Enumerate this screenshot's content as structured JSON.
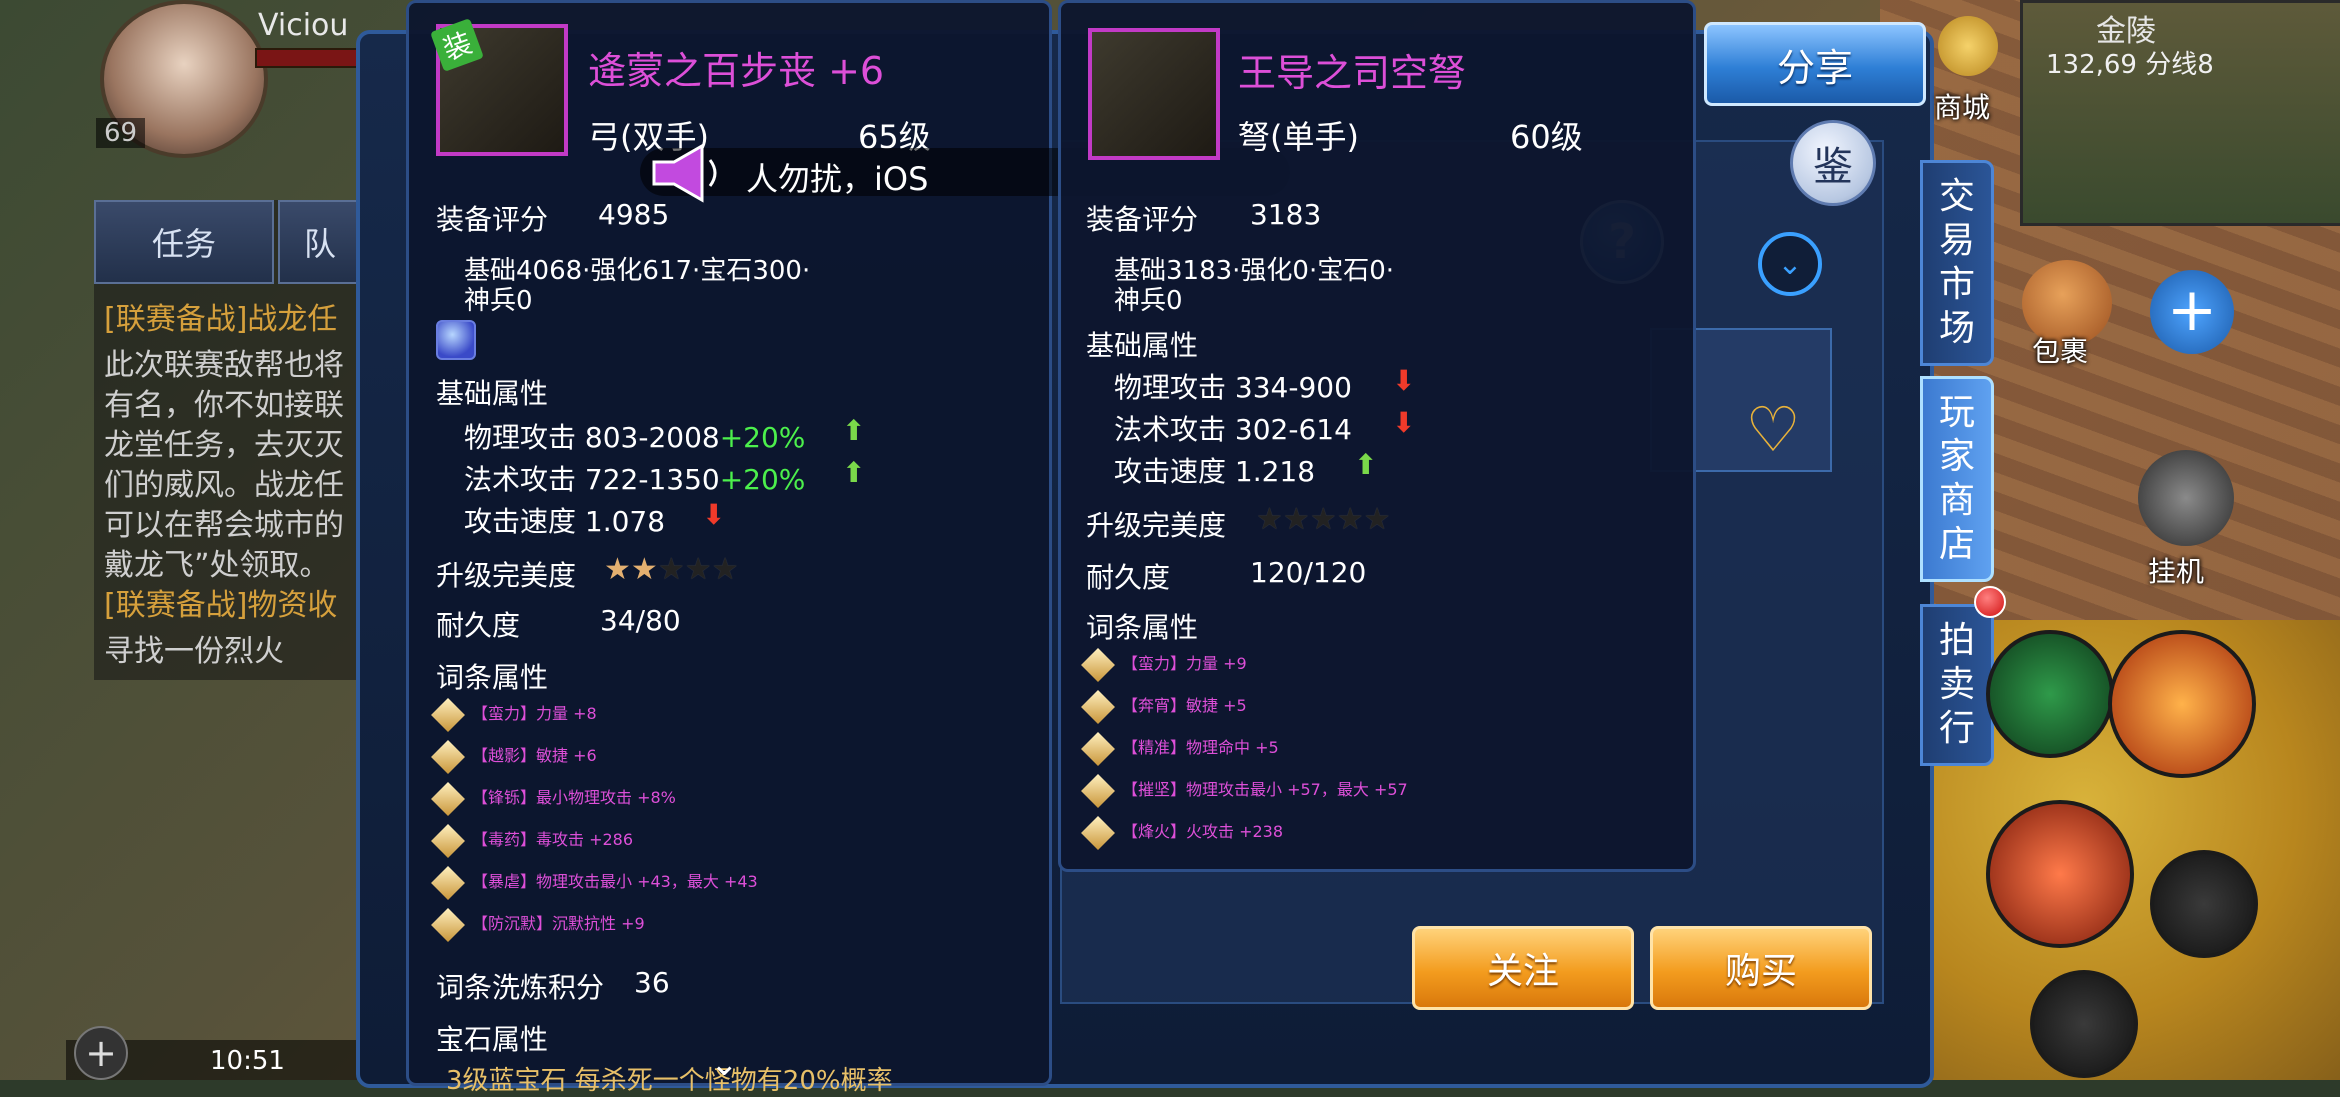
{
  "player": {
    "name": "Viciou",
    "level": "69"
  },
  "quest": {
    "tab_task": "任务",
    "tab_team": "队",
    "lines": [
      "[联赛备战]战龙任",
      "此次联赛敌帮也将",
      "有名，你不如接联",
      "龙堂任务，去灭灭",
      "们的威风。战龙任",
      "可以在帮会城市的",
      "戴龙飞”处领取。",
      "[联赛备战]物资收",
      "寻找一份烈火"
    ]
  },
  "status": {
    "time": "10:51"
  },
  "broadcast": {
    "text": "人勿扰，iOS"
  },
  "left_item": {
    "badge": "装",
    "name": "逄蒙之百步丧 +6",
    "type": "弓(双手)",
    "level": "65级",
    "score_label": "装备评分",
    "score": "4985",
    "score_breakdown_1": "基础4068·强化617·宝石300·",
    "score_breakdown_2": "神兵0",
    "base_header": "基础属性",
    "base_attrs": [
      {
        "name": "物理攻击 803-2008",
        "bonus": "+20%",
        "trend": "up"
      },
      {
        "name": "法术攻击 722-1350",
        "bonus": "+20%",
        "trend": "up"
      },
      {
        "name": "攻击速度 1.078",
        "bonus": "",
        "trend": "down"
      }
    ],
    "upgrade_label": "升级完美度",
    "upgrade_stars": 2,
    "upgrade_stars_max": 5,
    "durability_label": "耐久度",
    "durability": "34/80",
    "affix_header": "词条属性",
    "affixes": [
      "【蛮力】力量 +8",
      "【越影】敏捷 +6",
      "【锋铄】最小物理攻击 +8%",
      "【毒药】毒攻击 +286",
      "【暴虐】物理攻击最小 +43，最大 +43",
      "【防沉默】沉默抗性 +9"
    ],
    "refine_label": "词条洗炼积分",
    "refine_value": "36",
    "gem_header": "宝石属性",
    "gem_line": "3级蓝宝石 每杀死一个怪物有20%概率"
  },
  "right_item": {
    "name": "王导之司空弩",
    "type": "弩(单手)",
    "level": "60级",
    "score_label": "装备评分",
    "score": "3183",
    "score_breakdown_1": "基础3183·强化0·宝石0·",
    "score_breakdown_2": "神兵0",
    "base_header": "基础属性",
    "base_attrs": [
      {
        "name": "物理攻击 334-900",
        "trend": "down"
      },
      {
        "name": "法术攻击 302-614",
        "trend": "down"
      },
      {
        "name": "攻击速度 1.218",
        "trend": "up"
      }
    ],
    "upgrade_label": "升级完美度",
    "upgrade_stars": 0,
    "upgrade_stars_max": 5,
    "durability_label": "耐久度",
    "durability": "120/120",
    "affix_header": "词条属性",
    "affixes": [
      "【蛮力】力量 +9",
      "【奔宵】敏捷 +5",
      "【精准】物理命中 +5",
      "【摧坚】物理攻击最小 +57，最大 +57",
      "【烽火】火攻击 +238"
    ]
  },
  "buttons": {
    "share": "分享",
    "follow": "关注",
    "buy": "购买",
    "identify": "鉴",
    "help": "?"
  },
  "side_tabs": [
    {
      "label": "交易市场",
      "active": false
    },
    {
      "label": "玩家商店",
      "active": true
    },
    {
      "label": "拍卖行",
      "active": false
    }
  ],
  "map": {
    "name": "金陵",
    "coords": "132,69 分线8"
  },
  "hud": {
    "mall": "商城",
    "bag": "包裹",
    "auto": "挂机"
  },
  "colors": {
    "gold": "#e8c068",
    "green": "#4cf04c",
    "magenta": "#dd4fd8",
    "arrow_up": "#7ad94a",
    "arrow_down": "#f03a2a",
    "panel_border": "#2c4d86"
  }
}
